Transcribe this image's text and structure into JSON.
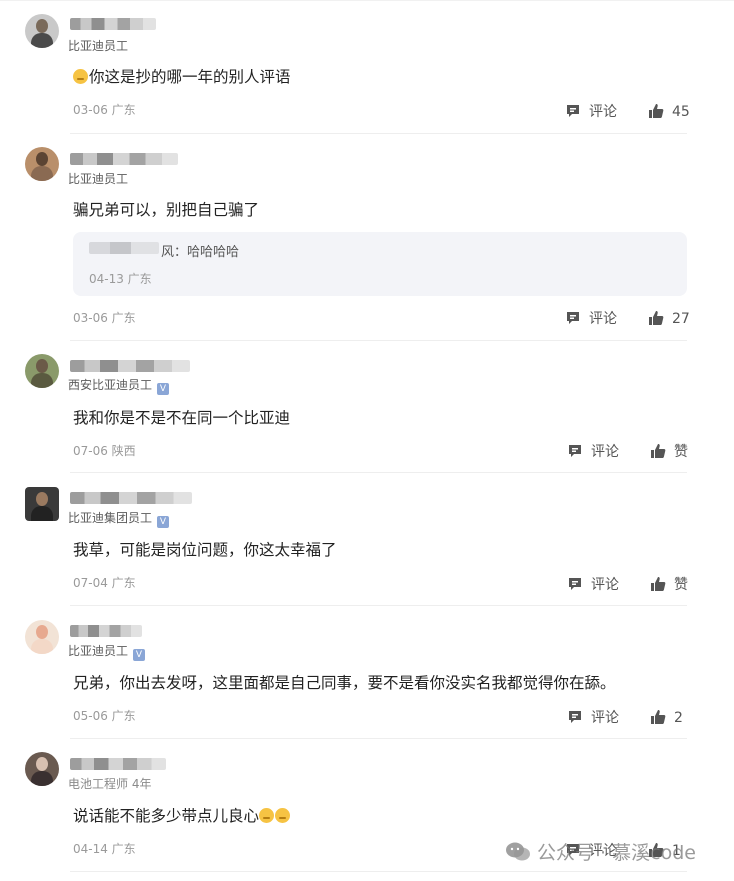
{
  "comments": [
    {
      "role": "比亚迪员工",
      "verified": false,
      "text": "你这是抄的哪一年的别人评语",
      "text_emoji_prefix": true,
      "meta": "03-06 广东",
      "comment_label": "评论",
      "like_label": "45"
    },
    {
      "role": "比亚迪员工",
      "verified": false,
      "text": "骗兄弟可以，别把自己骗了",
      "reply": {
        "text": "风：哈哈哈哈",
        "meta": "04-13 广东"
      },
      "meta": "03-06 广东",
      "comment_label": "评论",
      "like_label": "27"
    },
    {
      "role": "西安比亚迪员工",
      "verified": true,
      "text": "我和你是不是不在同一个比亚迪",
      "meta": "07-06 陕西",
      "comment_label": "评论",
      "like_label": "赞"
    },
    {
      "role": "比亚迪集团员工",
      "verified": true,
      "text": "我草，可能是岗位问题，你这太幸福了",
      "meta": "07-04 广东",
      "comment_label": "评论",
      "like_label": "赞"
    },
    {
      "role": "比亚迪员工",
      "verified": true,
      "text": "兄弟，你出去发呀，这里面都是自己同事，要不是看你没实名我都觉得你在舔。",
      "meta": "05-06 广东",
      "comment_label": "评论",
      "like_label": "2"
    },
    {
      "role": "电池工程师 4年",
      "verified": false,
      "text": "说话能不能多少带点儿良心",
      "text_emoji_suffix": 2,
      "meta": "04-14 广东",
      "comment_label": "评论",
      "like_label": "1"
    }
  ],
  "watermark": {
    "text": "公众号 · 慕溪code"
  },
  "colors": {
    "verified_badge": "#8aa6d6",
    "reply_bg": "#f3f4f8",
    "meta": "#9a9a9a"
  },
  "icons": {
    "comment": "comment-icon",
    "like": "thumbs-up-icon",
    "verified": "verified-badge-icon",
    "watermark": "wechat-icon"
  }
}
